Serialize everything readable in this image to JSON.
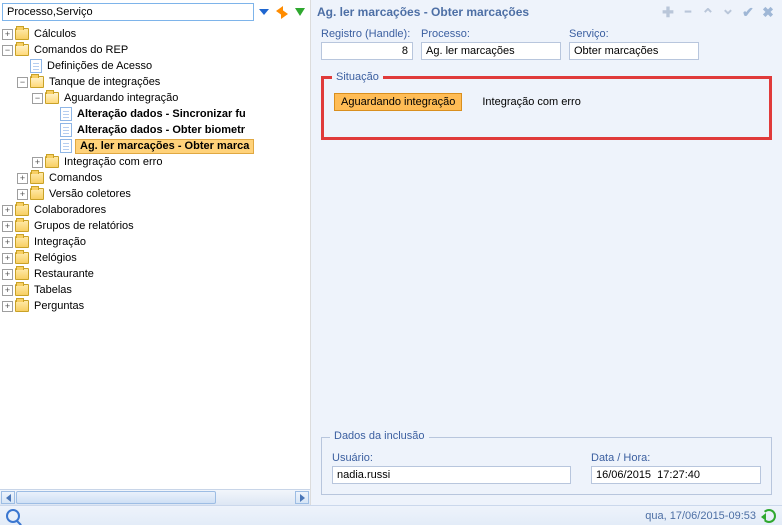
{
  "search": {
    "value": "Processo,Serviço"
  },
  "tree": {
    "calculos": "Cálculos",
    "comandos_rep": "Comandos do REP",
    "def_acesso": "Definições de Acesso",
    "tanque": "Tanque de integrações",
    "aguardando": "Aguardando integração",
    "alt_sinc": "Alteração dados - Sincronizar fu",
    "alt_bio": "Alteração dados - Obter biometr",
    "ag_ler": "Ag. ler marcações - Obter marca",
    "int_erro": "Integração com erro",
    "comandos": "Comandos",
    "versao": "Versão coletores",
    "colab": "Colaboradores",
    "grupos": "Grupos de relatórios",
    "integracao": "Integração",
    "relogios": "Relógios",
    "restaurante": "Restaurante",
    "tabelas": "Tabelas",
    "perguntas": "Perguntas"
  },
  "header": {
    "title": "Ag. ler marcações - Obter marcações"
  },
  "fields": {
    "registro_label": "Registro (Handle):",
    "registro_value": "8",
    "processo_label": "Processo:",
    "processo_value": "Ag. ler marcações",
    "servico_label": "Serviço:",
    "servico_value": "Obter marcações"
  },
  "situacao": {
    "title": "Situação",
    "aguardando": "Aguardando integração",
    "erro": "Integração com erro"
  },
  "inclusao": {
    "title": "Dados da inclusão",
    "usuario_label": "Usuário:",
    "usuario_value": "nadia.russi",
    "data_label": "Data / Hora:",
    "data_value": "16/06/2015  17:27:40"
  },
  "statusbar": {
    "datetime": "qua, 17/06/2015-09:53"
  }
}
